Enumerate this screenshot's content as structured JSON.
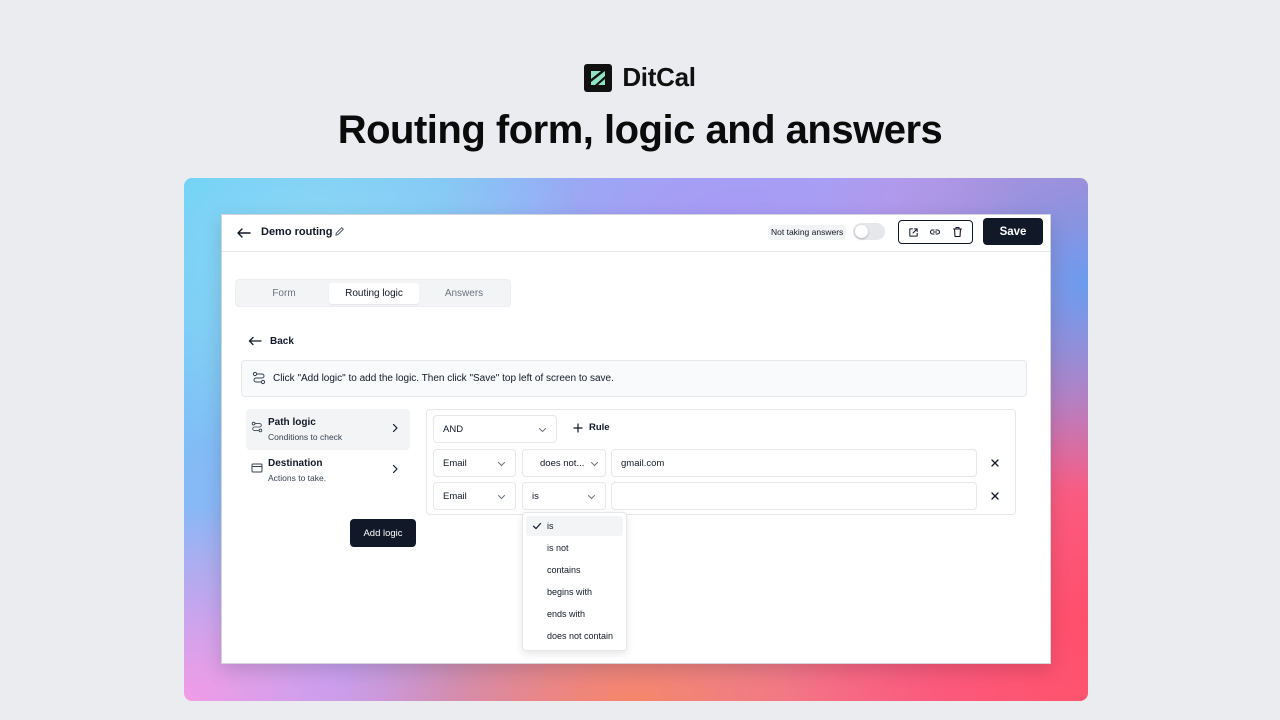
{
  "brand": {
    "name": "DitCal"
  },
  "headline": "Routing form, logic and answers",
  "topbar": {
    "title": "Demo routing",
    "not_taking_answers_label": "Not taking answers",
    "save_label": "Save"
  },
  "tabs": [
    {
      "label": "Form",
      "active": false
    },
    {
      "label": "Routing logic",
      "active": true
    },
    {
      "label": "Answers",
      "active": false
    }
  ],
  "back_label": "Back",
  "info_text": "Click \"Add logic\" to add the logic. Then click \"Save\" top left of screen to save.",
  "sidebar": {
    "items": [
      {
        "title": "Path logic",
        "subtitle": "Conditions to check",
        "active": true
      },
      {
        "title": "Destination",
        "subtitle": "Actions to take.",
        "active": false
      }
    ],
    "add_logic_label": "Add logic"
  },
  "rules": {
    "combinator": "AND",
    "add_rule_label": "Rule",
    "rows": [
      {
        "field": "Email",
        "operator": "does not...",
        "value": "gmail.com"
      },
      {
        "field": "Email",
        "operator": "is",
        "value": ""
      }
    ]
  },
  "operator_dropdown": {
    "selected": "is",
    "options": [
      "is",
      "is not",
      "contains",
      "begins with",
      "ends with",
      "does not contain"
    ]
  },
  "colors": {
    "primary": "#111827",
    "background": "#ebecef",
    "muted": "#f3f4f6",
    "border": "#e5e7eb"
  }
}
